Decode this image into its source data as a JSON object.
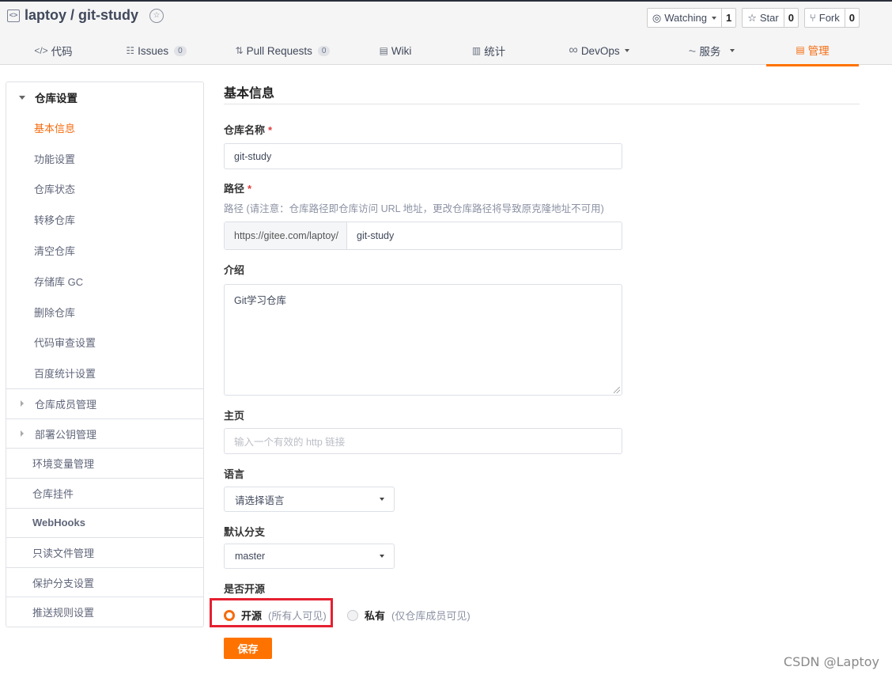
{
  "header": {
    "repo_title": "laptoy / git-study",
    "icons": {
      "repo": "code-box-icon",
      "badge": "award-badge-icon"
    },
    "actions": [
      {
        "icon": "eye-icon",
        "label": "Watching",
        "count": "1",
        "dropdown": true
      },
      {
        "icon": "star-icon",
        "label": "Star",
        "count": "0",
        "dropdown": false
      },
      {
        "icon": "fork-icon",
        "label": "Fork",
        "count": "0",
        "dropdown": false
      }
    ]
  },
  "tabs": [
    {
      "icon": "code-icon",
      "glyph": "</>",
      "label": "代码",
      "badge": null,
      "active": false
    },
    {
      "icon": "issues-icon",
      "glyph": "☷",
      "label": "Issues",
      "badge": "0",
      "active": false
    },
    {
      "icon": "pull-request-icon",
      "glyph": "⇅",
      "label": "Pull Requests",
      "badge": "0",
      "active": false
    },
    {
      "icon": "wiki-book-icon",
      "glyph": "▤",
      "label": "Wiki",
      "badge": null,
      "active": false
    },
    {
      "icon": "stats-chart-icon",
      "glyph": "▥",
      "label": "统计",
      "badge": null,
      "active": false
    },
    {
      "icon": "devops-infinity-icon",
      "glyph": "∞",
      "label": "DevOps",
      "badge": null,
      "active": false,
      "dropdown": true
    },
    {
      "icon": "service-pulse-icon",
      "glyph": "⏦",
      "label": "服务",
      "badge": null,
      "active": false,
      "dropdown": true
    },
    {
      "icon": "manage-doc-icon",
      "glyph": "▤",
      "label": "管理",
      "badge": null,
      "active": true
    }
  ],
  "sidebar": {
    "group": {
      "label": "仓库设置",
      "items": [
        {
          "label": "基本信息",
          "active": true
        },
        {
          "label": "功能设置",
          "active": false
        },
        {
          "label": "仓库状态",
          "active": false
        },
        {
          "label": "转移仓库",
          "active": false
        },
        {
          "label": "清空仓库",
          "active": false
        },
        {
          "label": "存储库 GC",
          "active": false
        },
        {
          "label": "删除仓库",
          "active": false
        },
        {
          "label": "代码审查设置",
          "active": false
        },
        {
          "label": "百度统计设置",
          "active": false
        }
      ]
    },
    "sections": [
      {
        "label": "仓库成员管理",
        "expandable": true
      },
      {
        "label": "部署公钥管理",
        "expandable": true
      },
      {
        "label": "环境变量管理",
        "expandable": false
      },
      {
        "label": "仓库挂件",
        "expandable": false
      },
      {
        "label": "WebHooks",
        "expandable": false
      },
      {
        "label": "只读文件管理",
        "expandable": false
      },
      {
        "label": "保护分支设置",
        "expandable": false
      },
      {
        "label": "推送规则设置",
        "expandable": false
      }
    ]
  },
  "form": {
    "title": "基本信息",
    "required_mark": "*",
    "repo_name": {
      "label": "仓库名称",
      "value": "git-study"
    },
    "path": {
      "label": "路径",
      "hint": "路径 (请注意：仓库路径即仓库访问 URL 地址，更改仓库路径将导致原克隆地址不可用)",
      "prefix": "https://gitee.com/laptoy/",
      "value": "git-study"
    },
    "intro": {
      "label": "介绍",
      "value": "Git学习仓库"
    },
    "homepage": {
      "label": "主页",
      "value": "",
      "placeholder": "输入一个有效的 http 链接"
    },
    "language": {
      "label": "语言",
      "selected": "请选择语言"
    },
    "default_branch": {
      "label": "默认分支",
      "selected": "master"
    },
    "visibility": {
      "label": "是否开源",
      "options": [
        {
          "label": "开源",
          "note": "(所有人可见)",
          "selected": true
        },
        {
          "label": "私有",
          "note": "(仅仓库成员可见)",
          "selected": false
        }
      ]
    },
    "save_label": "保存"
  },
  "colors": {
    "accent": "#fe7300",
    "highlight_box": "#e52030",
    "required": "#e03a3a"
  },
  "watermark": "CSDN @Laptoy"
}
